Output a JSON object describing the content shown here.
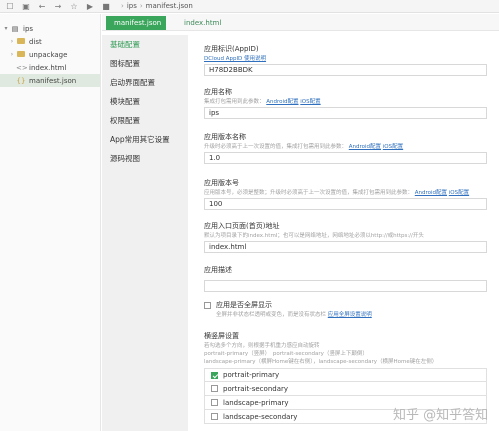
{
  "toolbar": {
    "crumbs": [
      "ips",
      "manifest.json"
    ]
  },
  "explorer": {
    "root": "ips",
    "items": [
      {
        "label": "dist",
        "type": "folder"
      },
      {
        "label": "unpackage",
        "type": "folder"
      },
      {
        "label": "index.html",
        "type": "file"
      },
      {
        "label": "manifest.json",
        "type": "file"
      }
    ]
  },
  "tabs": [
    {
      "label": "manifest.json",
      "active": true
    },
    {
      "label": "index.html",
      "active": false
    }
  ],
  "nav": [
    {
      "label": "基础配置",
      "active": true
    },
    {
      "label": "图标配置",
      "active": false
    },
    {
      "label": "启动界面配置",
      "active": false
    },
    {
      "label": "模块配置",
      "active": false
    },
    {
      "label": "权限配置",
      "active": false
    },
    {
      "label": "App常用其它设置",
      "active": false
    },
    {
      "label": "源码视图",
      "active": false
    }
  ],
  "form": {
    "appid": {
      "label": "应用标识(AppID)",
      "link": "DCloud AppID 使用说明",
      "value": "H78D2BBDK"
    },
    "name": {
      "label": "应用名称",
      "desc": "集成打包需用到此参数：",
      "links": [
        "Android配置",
        "iOS配置"
      ],
      "value": "ips"
    },
    "version_name": {
      "label": "应用版本名称",
      "desc": "升级时必须高于上一次设置的值，集成打包需用到此参数：",
      "links": [
        "Android配置",
        "iOS配置"
      ],
      "value": "1.0"
    },
    "version_code": {
      "label": "应用版本号",
      "desc": "应用版本号，必须是整数；升级时必须高于上一次设置的值，集成打包需用到此参数：",
      "links": [
        "Android配置",
        "iOS配置"
      ],
      "value": "100"
    },
    "entry": {
      "label": "应用入口页面(首页)地址",
      "desc": "默认为项目录下的index.html；也可以是网络地址，网络地址必须以http://或https://开头",
      "value": "index.html"
    },
    "description": {
      "label": "应用描述",
      "value": ""
    },
    "fullscreen": {
      "label": "应用是否全屏显示",
      "desc": "全屏并非状态栏透明或变色，而是没有状态栏",
      "link": "应用全屏设置说明",
      "checked": false
    },
    "orientation": {
      "label": "横竖屏设置",
      "desc": [
        "若勾选多个方向，则根据手机重力感应自动旋转",
        "portrait-primary（竖屏）　portrait-secondary（竖屏上下颠倒）",
        "landscape-primary（横屏Home键在右侧），landscape-secondary（横屏Home键在左侧）"
      ],
      "options": [
        {
          "label": "portrait-primary",
          "checked": true
        },
        {
          "label": "portrait-secondary",
          "checked": false
        },
        {
          "label": "landscape-primary",
          "checked": false
        },
        {
          "label": "landscape-secondary",
          "checked": false
        }
      ]
    }
  },
  "watermark": "知乎 @知乎答知",
  "colors": {
    "accent": "#3aa65c",
    "link": "#2f6fbd"
  }
}
